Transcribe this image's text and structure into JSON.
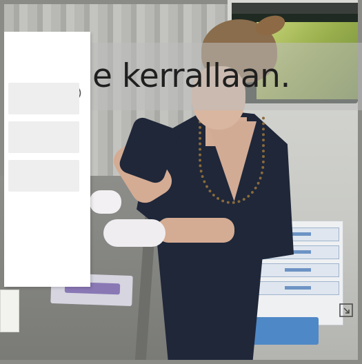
{
  "video": {
    "caption": "e kerrallaan.",
    "fullscreen_icon": "fullscreen-exit-icon"
  },
  "panel": {
    "speaker_icon": "speaker-icon",
    "options": [
      "",
      "",
      ""
    ]
  },
  "colors": {
    "panel_bg": "#ffffff",
    "option_bg": "#eeeeee",
    "scrubs": "#1f2739"
  }
}
